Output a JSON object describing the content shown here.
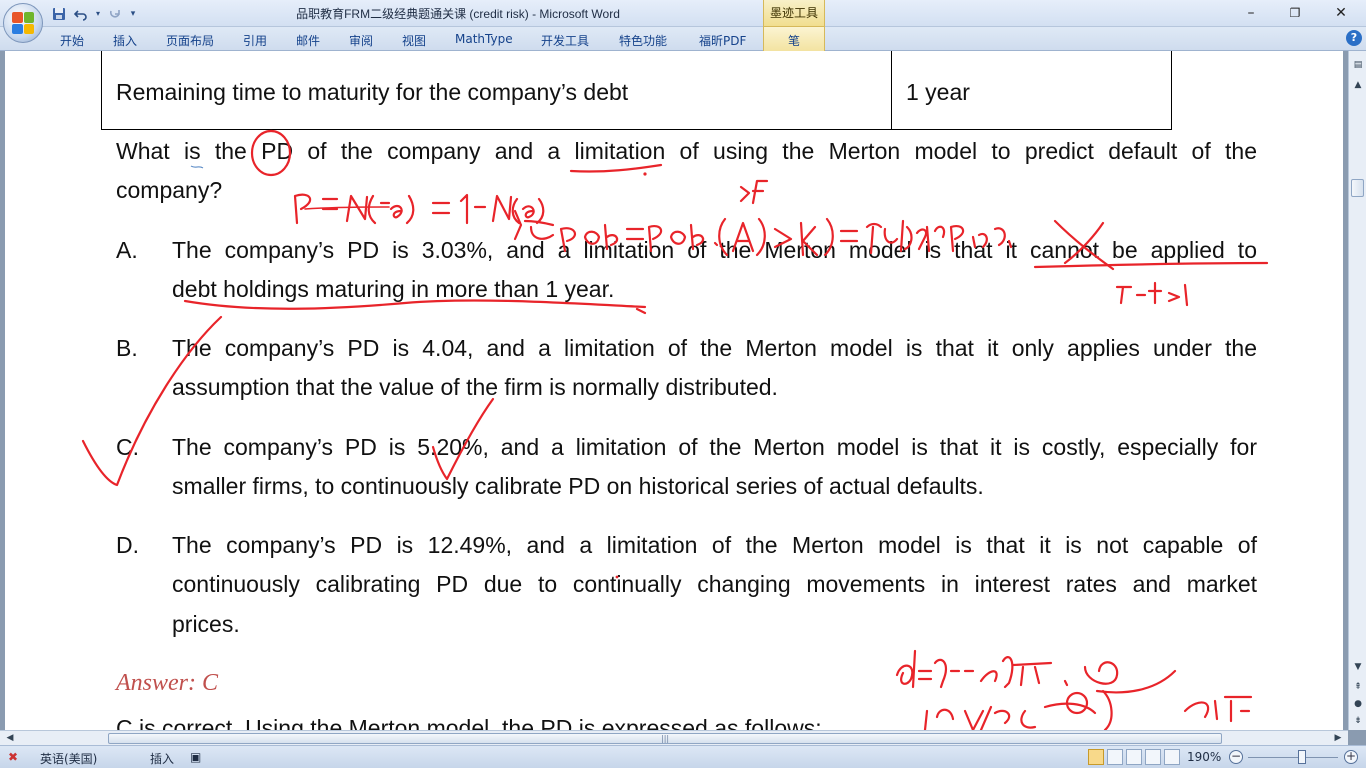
{
  "window": {
    "title": "品职教育FRM二级经典题通关课 (credit risk) - Microsoft Word",
    "contextual_tab_header": "墨迹工具",
    "controls": {
      "minimize": "–",
      "restore": "❐",
      "close": "✕"
    }
  },
  "quick_access": {
    "save_icon": "save-icon",
    "undo_icon": "undo-icon",
    "redo_icon": "redo-icon"
  },
  "ribbon": {
    "tabs": [
      "开始",
      "插入",
      "页面布局",
      "引用",
      "邮件",
      "审阅",
      "视图",
      "MathType",
      "开发工具",
      "特色功能",
      "福昕PDF"
    ],
    "ink_tab": "笔",
    "help": "?"
  },
  "document": {
    "table_row": {
      "label": "Remaining time to maturity for the company’s debt",
      "value": "1 year"
    },
    "question_line1": "What is the PD of the company and a limitation of using the Merton model to predict default of the",
    "question_line2": "company?",
    "options": [
      {
        "letter": "A.",
        "line1": "The company’s PD is 3.03%, and a limitation of the Merton model is that it cannot be applied to",
        "line2": "debt holdings maturing in more than 1 year."
      },
      {
        "letter": "B.",
        "line1": "The company’s PD is 4.04, and a limitation of the Merton model is that it only applies under the",
        "line2": "assumption that the value of the firm is normally distributed."
      },
      {
        "letter": "C.",
        "line1": "The company’s PD is 5.20%, and a limitation of the Merton model is that it is costly, especially for",
        "line2": "smaller firms, to continuously calibrate PD on historical series of actual defaults."
      },
      {
        "letter": "D.",
        "line1": "The company’s PD is 12.49%, and a limitation of the Merton model is that it is not capable of",
        "line2": "continuously calibrating PD due to continually changing movements in interest rates and market",
        "line3": "prices."
      }
    ],
    "answer": "Answer: C",
    "explanation_partial": "C is correct. Using the Merton model, the PD is expressed as follows:"
  },
  "status_bar": {
    "language": "英语(美国)",
    "insert_mode": "插入",
    "zoom": "190%"
  },
  "colors": {
    "ink": "#e8242a",
    "answer": "#c0504d",
    "title_bar": "#dfe9f6",
    "ribbon_text": "#15428b"
  }
}
